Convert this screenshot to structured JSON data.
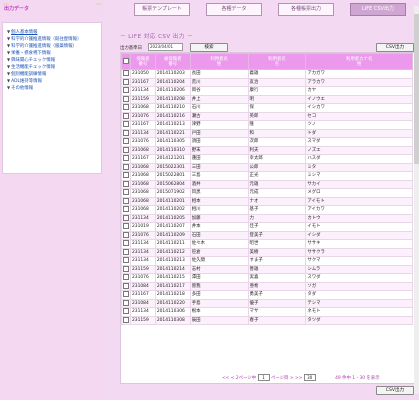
{
  "sidebar": {
    "title": "出力データ",
    "items": [
      {
        "label": "個人基本情報",
        "active": true
      },
      {
        "label": "科学的介護推進情報（既往歴情報）"
      },
      {
        "label": "科学的介護推進情報（服薬情報）"
      },
      {
        "label": "栄養・摂食嚥下情報"
      },
      {
        "label": "興味関心チェック情報"
      },
      {
        "label": "生活機能チェック情報"
      },
      {
        "label": "個別機能訓練情報"
      },
      {
        "label": "ADL維持等情報"
      },
      {
        "label": "その他情報"
      }
    ]
  },
  "tabs": [
    {
      "label": "帳票テンプレート"
    },
    {
      "label": "各種データ"
    },
    {
      "label": "各種帳票出力"
    },
    {
      "label": "LIFE CSV出力",
      "active": true
    }
  ],
  "section_title": "－ LIFE 対応 CSV 出力 －",
  "form": {
    "date_label": "出力基準日",
    "date_value": "2023/04/01",
    "search_label": "検索",
    "csv_label": "CSV出力"
  },
  "table": {
    "headers": [
      "",
      "保険者\n番号",
      "被保険者\n番号",
      "利用者名\n姓",
      "利用者名\n名",
      "利用者カナ名\n姓"
    ],
    "rows": [
      [
        "231050",
        "2014110203",
        "長田",
        "義雄",
        "アカガワ"
      ],
      [
        "231167",
        "2014110204",
        "荒川",
        "友治",
        "アラカワ"
      ],
      [
        "231134",
        "2014110206",
        "岡谷",
        "康行",
        "カヤ"
      ],
      [
        "231159",
        "2014110208",
        "井上",
        "明",
        "イノウエ"
      ],
      [
        "231068",
        "2014110210",
        "石川",
        "保",
        "イシカワ"
      ],
      [
        "231076",
        "2014110216",
        "瀬古",
        "英郎",
        "セコ"
      ],
      [
        "231167",
        "2014110213",
        "津野",
        "隆",
        "ツノ"
      ],
      [
        "231134",
        "2014110221",
        "戸田",
        "和",
        "トダ"
      ],
      [
        "231076",
        "2014110305",
        "須田",
        "次郎",
        "スマダ"
      ],
      [
        "231068",
        "2014110310",
        "野末",
        "利夫",
        "ノズエ"
      ],
      [
        "231167",
        "2014121201",
        "蓮田",
        "幸太郎",
        "ハスダ"
      ],
      [
        "231068",
        "2015022301",
        "三田",
        "公郎",
        "ミタ"
      ],
      [
        "231068",
        "2015022801",
        "三島",
        "正光",
        "ミシマ"
      ],
      [
        "231068",
        "2015062804",
        "酒井",
        "元雄",
        "サカイ"
      ],
      [
        "231068",
        "2015071902",
        "目黒",
        "元成",
        "メグロ"
      ],
      [
        "231068",
        "2014110201",
        "相本",
        "ナオ",
        "アイモト"
      ],
      [
        "231068",
        "2014110202",
        "相川",
        "基子",
        "アイカワ"
      ],
      [
        "231134",
        "2014110205",
        "加藤",
        "力",
        "カトウ"
      ],
      [
        "231019",
        "2014110207",
        "井本",
        "佳子",
        "イモト"
      ],
      [
        "231076",
        "2014110209",
        "石田",
        "登美子",
        "イシダ"
      ],
      [
        "231134",
        "2014110211",
        "佐々木",
        "昭世",
        "ササキ"
      ],
      [
        "231134",
        "2014110212",
        "笹倉",
        "美樹",
        "ササクラ"
      ],
      [
        "231134",
        "2014110213",
        "佐久間",
        "すま子",
        "サクマ"
      ],
      [
        "231159",
        "2014110214",
        "志村",
        "善雄",
        "シムラ"
      ],
      [
        "231076",
        "2014110215",
        "澤田",
        "実喜",
        "スワダ"
      ],
      [
        "231084",
        "2014110217",
        "曽我",
        "亜希",
        "ソガ"
      ],
      [
        "231167",
        "2014110218",
        "多田",
        "勇美子",
        "タダ"
      ],
      [
        "231084",
        "2014110220",
        "手島",
        "優子",
        "テシマ"
      ],
      [
        "231134",
        "2014110306",
        "根本",
        "マサ",
        "ネモト"
      ],
      [
        "231159",
        "2014110308",
        "辰田",
        "春子",
        "タツダ"
      ]
    ]
  },
  "pager": {
    "first": "<<",
    "prev": "<",
    "page_text": "2ページ中",
    "page_value": "1",
    "page_suffix": "ページ目",
    "next": ">",
    "last": ">>",
    "per_page": "30",
    "summary": "49 件中 1 - 30 を表示"
  }
}
